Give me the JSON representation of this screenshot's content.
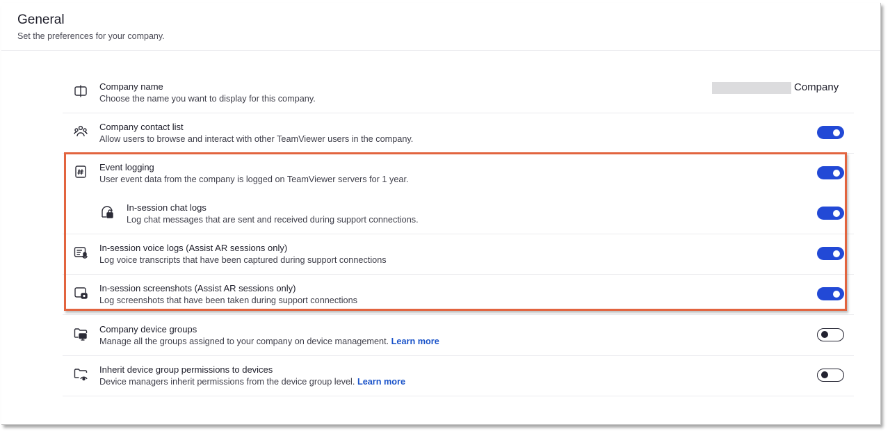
{
  "header": {
    "title": "General",
    "subtitle": "Set the preferences for your company."
  },
  "settings": [
    {
      "id": "company-name",
      "icon": "card-icon",
      "title": "Company name",
      "description": "Choose the name you want to display for this company.",
      "value": "Company",
      "value_redacted": true
    },
    {
      "id": "company-contact-list",
      "icon": "contacts-icon",
      "title": "Company contact list",
      "description": "Allow users to browse and interact with other TeamViewer users in the company.",
      "enabled": true
    },
    {
      "id": "event-logging",
      "icon": "hash-log-icon",
      "title": "Event logging",
      "description": "User event data from the company is logged on TeamViewer servers for 1 year.",
      "enabled": true
    },
    {
      "id": "in-session-chat-logs",
      "icon": "chat-lock-icon",
      "title": "In-session chat logs",
      "description": "Log chat messages that are sent and received during support connections.",
      "enabled": true
    },
    {
      "id": "in-session-voice-logs",
      "icon": "voice-transcript-icon",
      "title": "In-session voice logs (Assist AR sessions only)",
      "description": "Log voice transcripts that have been captured during support connections",
      "enabled": true
    },
    {
      "id": "in-session-screenshots",
      "icon": "screenshot-icon",
      "title": "In-session screenshots (Assist AR sessions only)",
      "description": "Log screenshots that have been taken during support connections",
      "enabled": true
    },
    {
      "id": "company-device-groups",
      "icon": "device-group-icon",
      "title": "Company device groups",
      "description": "Manage all the groups assigned to your company on device management.",
      "link": "Learn more",
      "enabled": false
    },
    {
      "id": "inherit-device-group-permissions",
      "icon": "inherit-permissions-icon",
      "title": "Inherit device group permissions to devices",
      "description": "Device managers inherit permissions from the device group level.",
      "link": "Learn more",
      "enabled": false
    }
  ],
  "colors": {
    "toggle_on": "#2249d6",
    "link": "#1a53c9",
    "highlight_border": "#e2643f"
  }
}
